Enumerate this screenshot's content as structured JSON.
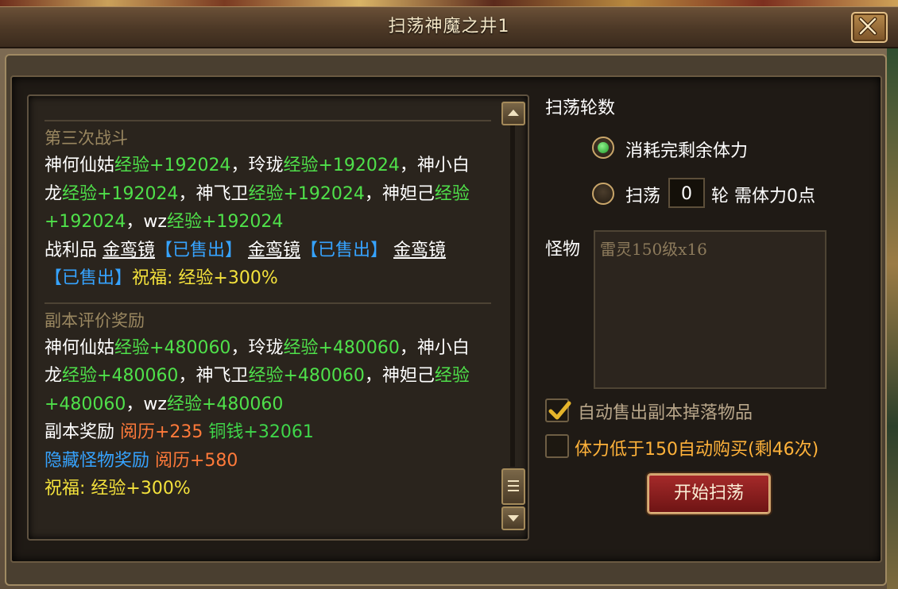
{
  "window": {
    "title": "扫荡神魔之井1"
  },
  "log": {
    "battle_section": {
      "heading": "第三次战斗",
      "lines": [
        [
          {
            "t": "神何仙姑",
            "c": "white"
          },
          {
            "t": "经验+192024",
            "c": "green"
          },
          {
            "t": "，玲珑",
            "c": "white"
          },
          {
            "t": "经验+192024",
            "c": "green"
          },
          {
            "t": "，神小白",
            "c": "white"
          }
        ],
        [
          {
            "t": "龙",
            "c": "white"
          },
          {
            "t": "经验+192024",
            "c": "green"
          },
          {
            "t": "，神飞卫",
            "c": "white"
          },
          {
            "t": "经验+192024",
            "c": "green"
          },
          {
            "t": "，神妲己",
            "c": "white"
          },
          {
            "t": "经验",
            "c": "green"
          }
        ],
        [
          {
            "t": "+192024",
            "c": "green"
          },
          {
            "t": "，wz",
            "c": "white"
          },
          {
            "t": "经验+192024",
            "c": "green"
          }
        ],
        [
          {
            "t": "战利品 ",
            "c": "white"
          },
          {
            "t": "金鸾镜",
            "c": "item"
          },
          {
            "t": "【已售出】 ",
            "c": "blue"
          },
          {
            "t": "金鸾镜",
            "c": "item"
          },
          {
            "t": "【已售出】 ",
            "c": "blue"
          },
          {
            "t": "金鸾镜",
            "c": "item"
          }
        ],
        [
          {
            "t": "【已售出】",
            "c": "blue"
          },
          {
            "t": "祝福: 经验+300%",
            "c": "yellow"
          }
        ]
      ]
    },
    "reward_section": {
      "heading": "副本评价奖励",
      "lines": [
        [
          {
            "t": "神何仙姑",
            "c": "white"
          },
          {
            "t": "经验+480060",
            "c": "green"
          },
          {
            "t": "，玲珑",
            "c": "white"
          },
          {
            "t": "经验+480060",
            "c": "green"
          },
          {
            "t": "，神小白",
            "c": "white"
          }
        ],
        [
          {
            "t": "龙",
            "c": "white"
          },
          {
            "t": "经验+480060",
            "c": "green"
          },
          {
            "t": "，神飞卫",
            "c": "white"
          },
          {
            "t": "经验+480060",
            "c": "green"
          },
          {
            "t": "，神妲己",
            "c": "white"
          },
          {
            "t": "经验",
            "c": "green"
          }
        ],
        [
          {
            "t": "+480060",
            "c": "green"
          },
          {
            "t": "，wz",
            "c": "white"
          },
          {
            "t": "经验+480060",
            "c": "green"
          }
        ],
        [
          {
            "t": "副本奖励 ",
            "c": "white"
          },
          {
            "t": "阅历+235 ",
            "c": "orange"
          },
          {
            "t": "铜钱+32061",
            "c": "hl-green"
          }
        ],
        [
          {
            "t": "隐藏怪物奖励 ",
            "c": "blue"
          },
          {
            "t": "阅历+580",
            "c": "orange"
          }
        ],
        [
          {
            "t": "祝福: 经验+300%",
            "c": "yellow"
          }
        ]
      ]
    }
  },
  "sweep": {
    "rounds_label": "扫荡轮数",
    "option_all_label": "消耗完剩余体力",
    "option_rounds_prefix": "扫荡",
    "rounds_value": "0",
    "option_rounds_suffix": "轮 需体力0点",
    "selected": "all"
  },
  "monster": {
    "label": "怪物",
    "value": "雷灵150级x16"
  },
  "options": {
    "auto_sell_label": "自动售出副本掉落物品",
    "auto_sell_checked": true,
    "auto_buy_label": "体力低于150自动购买(剩46次)",
    "auto_buy_checked": false
  },
  "start_button": {
    "label": "开始扫荡"
  },
  "colors": {
    "white": "#ffffff",
    "green": "#4fe04a",
    "yellow": "#f4e23c",
    "orange": "#ff7a3a",
    "blue": "#36a3ff",
    "hl-green": "#3fd54a",
    "heading": "#9a8760",
    "auto_buy_text": "#ffb23a",
    "auto_sell_text": "#b8a68a"
  }
}
